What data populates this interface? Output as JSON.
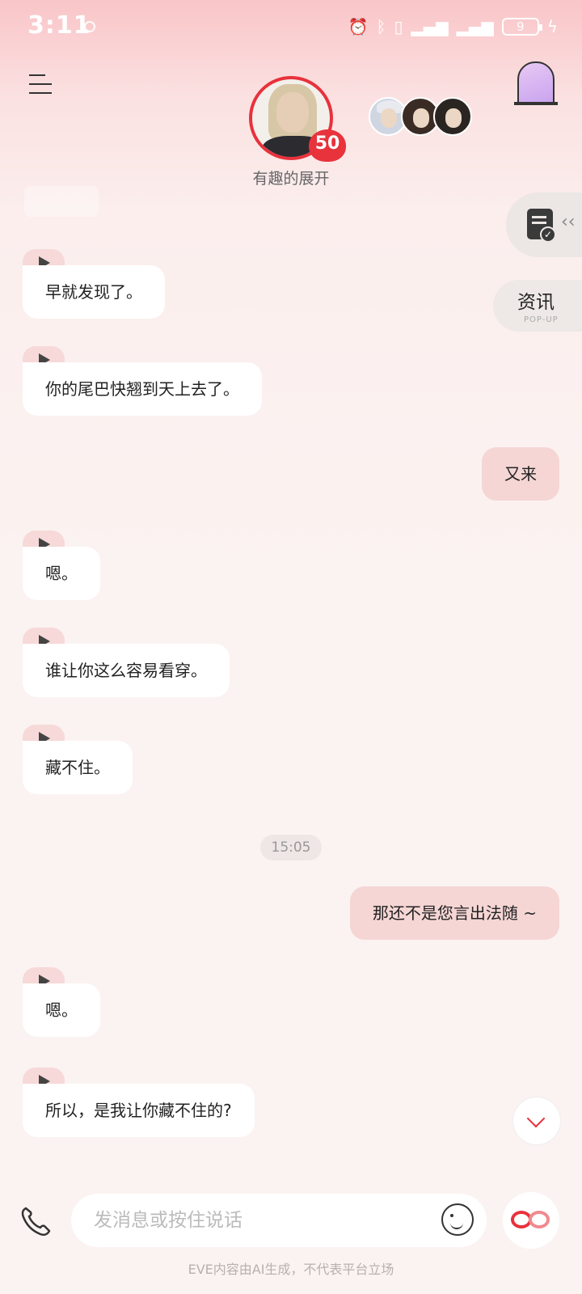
{
  "status_bar": {
    "time": "3:11",
    "battery": "9"
  },
  "header": {
    "character_name": "有趣的展开",
    "affinity": "50"
  },
  "side": {
    "news_label": "资讯",
    "news_sub": "POP-UP"
  },
  "messages": [
    {
      "from": "them",
      "text": "早就发现了。"
    },
    {
      "from": "them",
      "text": "你的尾巴快翘到天上去了。"
    },
    {
      "from": "me",
      "text": "又来"
    },
    {
      "from": "them",
      "text": "嗯。"
    },
    {
      "from": "them",
      "text": "谁让你这么容易看穿。"
    },
    {
      "from": "them",
      "text": "藏不住。"
    },
    {
      "from": "timestamp",
      "text": "15:05"
    },
    {
      "from": "me",
      "text": "那还不是您言出法随 ~"
    },
    {
      "from": "them",
      "text": "嗯。"
    },
    {
      "from": "them",
      "text": "所以，是我让你藏不住的?"
    }
  ],
  "input": {
    "placeholder": "发消息或按住说话"
  },
  "footer": {
    "disclaimer": "EVE内容由AI生成，不代表平台立场"
  },
  "colors": {
    "accent": "#e8323c",
    "outgoing_bubble": "#f5d6d5",
    "incoming_bubble": "#ffffff"
  }
}
